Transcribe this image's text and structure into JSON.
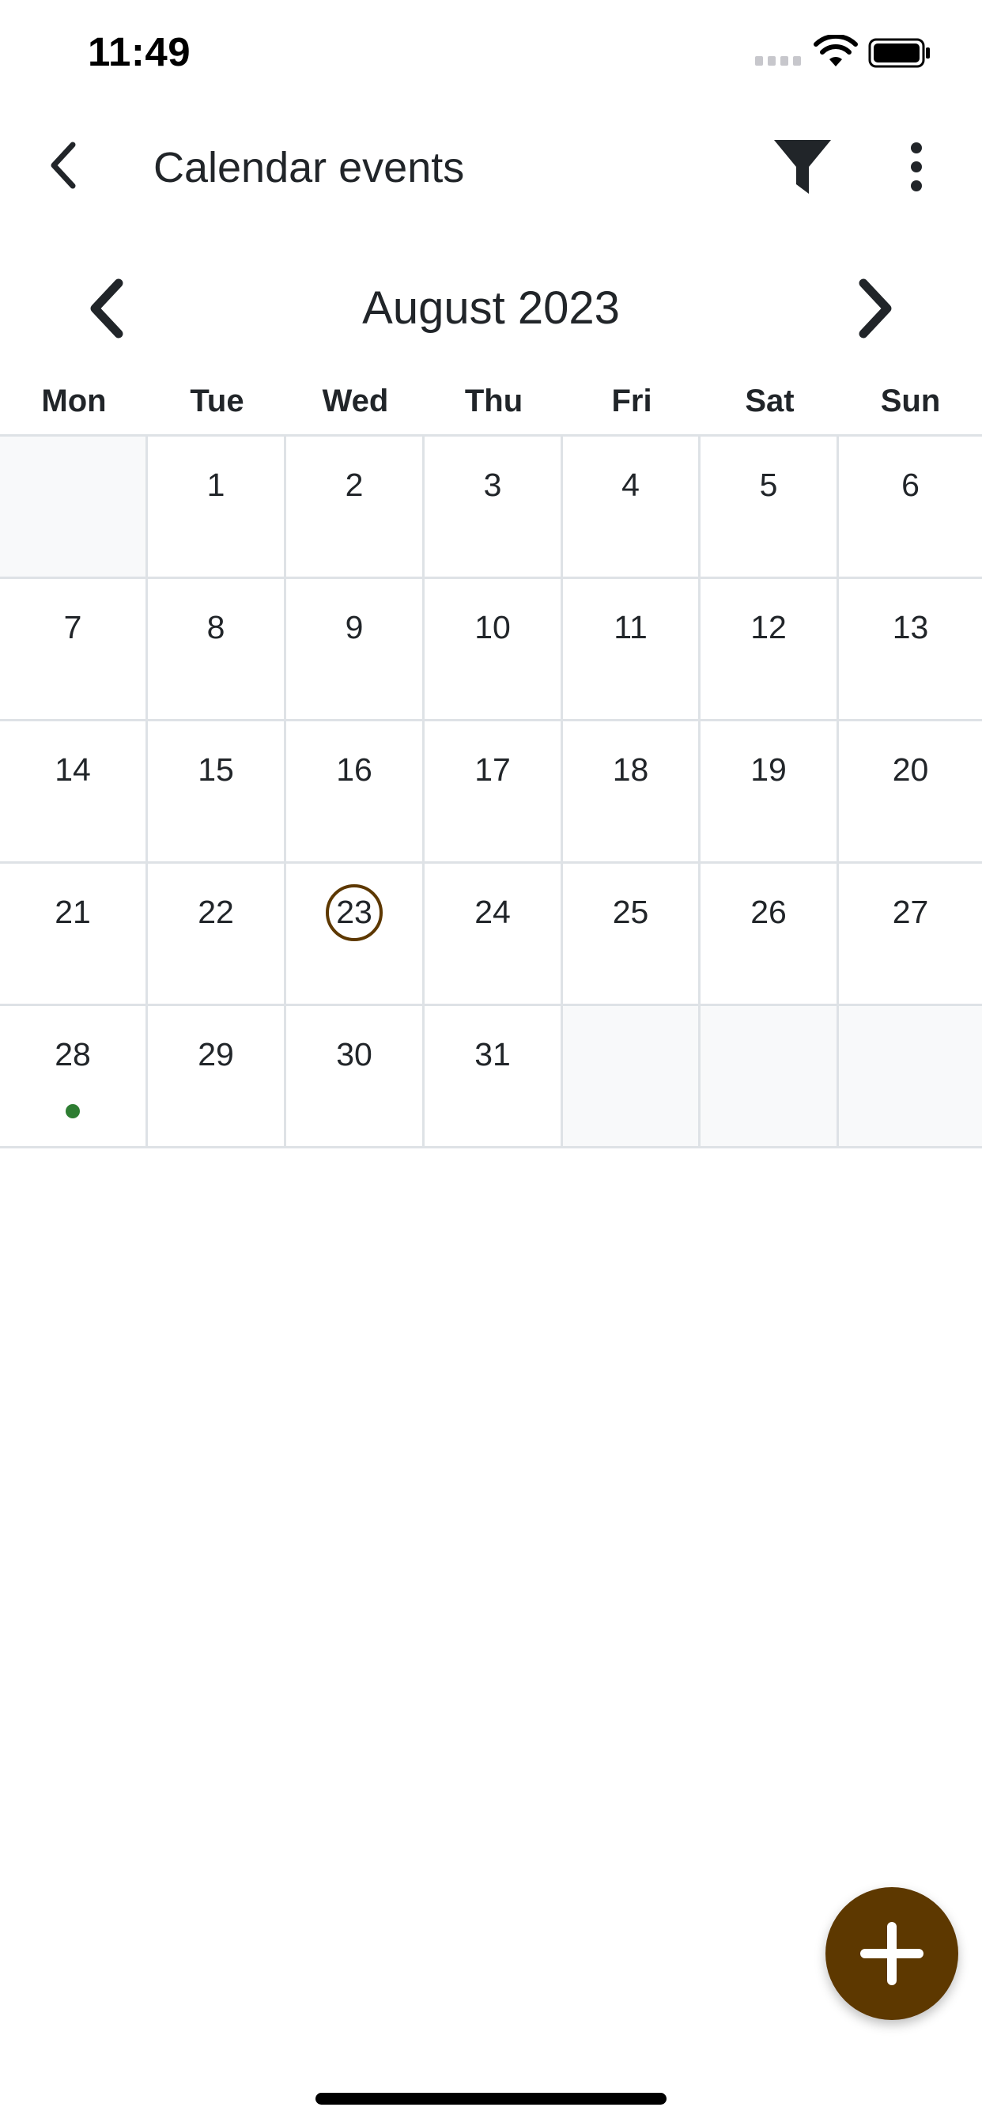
{
  "status_bar": {
    "time": "11:49",
    "icons": [
      "cellular-signal-icon",
      "wifi-icon",
      "battery-icon"
    ]
  },
  "header": {
    "title": "Calendar events",
    "back_icon": "chevron-left-icon",
    "filter_icon": "filter-icon",
    "more_icon": "more-vertical-icon"
  },
  "calendar": {
    "month_label": "August 2023",
    "prev_icon": "chevron-left-icon",
    "next_icon": "chevron-right-icon",
    "weekdays": [
      "Mon",
      "Tue",
      "Wed",
      "Thu",
      "Fri",
      "Sat",
      "Sun"
    ],
    "weeks": [
      [
        "",
        "1",
        "2",
        "3",
        "4",
        "5",
        "6"
      ],
      [
        "7",
        "8",
        "9",
        "10",
        "11",
        "12",
        "13"
      ],
      [
        "14",
        "15",
        "16",
        "17",
        "18",
        "19",
        "20"
      ],
      [
        "21",
        "22",
        "23",
        "24",
        "25",
        "26",
        "27"
      ],
      [
        "28",
        "29",
        "30",
        "31",
        "",
        "",
        ""
      ]
    ],
    "today": "23",
    "event_days": [
      "28"
    ]
  },
  "fab": {
    "icon": "plus-icon"
  },
  "colors": {
    "accent": "#5d3800",
    "event_dot": "#2e7d32",
    "grid_line": "#dee2e6",
    "empty_cell": "#f8f9fa",
    "text": "#212529"
  }
}
